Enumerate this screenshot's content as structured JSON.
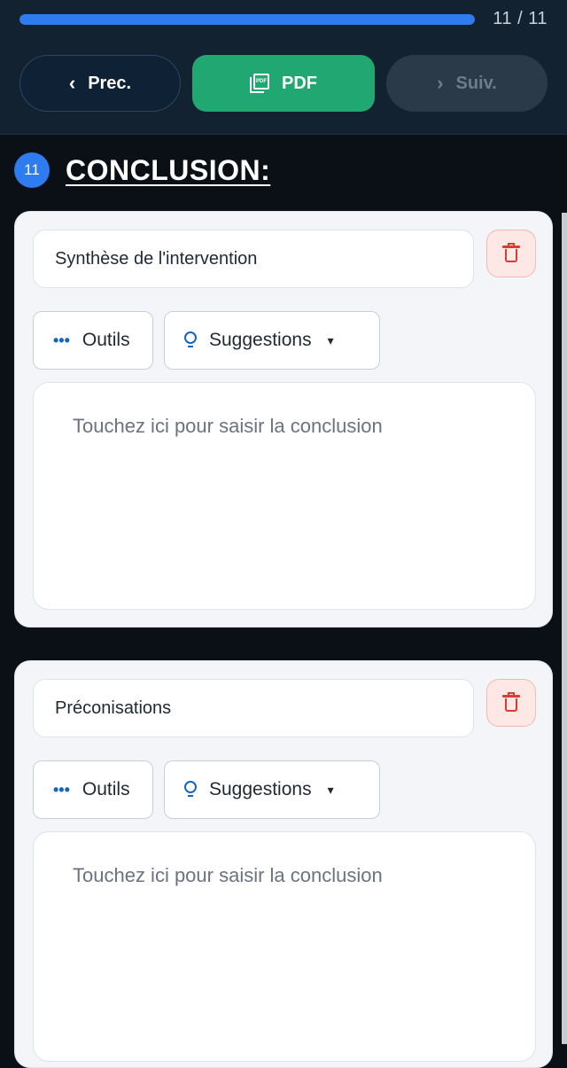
{
  "progress": {
    "label": "11 / 11",
    "fraction": 1.0,
    "color": "#2f7bf0"
  },
  "nav": {
    "prev_label": "Prec.",
    "pdf_label": "PDF",
    "pdf_icon_text": "PDF",
    "next_label": "Suiv."
  },
  "section": {
    "number": "11",
    "title": "CONCLUSION:"
  },
  "cards": [
    {
      "title": "Synthèse de l'intervention",
      "tools_label": "Outils",
      "suggestions_label": "Suggestions",
      "placeholder": "Touchez ici pour saisir la conclusion"
    },
    {
      "title": "Préconisations",
      "tools_label": "Outils",
      "suggestions_label": "Suggestions",
      "placeholder": "Touchez ici pour saisir la conclusion"
    }
  ],
  "colors": {
    "accent": "#2f7bf0",
    "pdf_button": "#21a872",
    "delete": "#dc3b2f",
    "icon_blue": "#1565c0"
  },
  "icons": [
    "chevron-left-icon",
    "pdf-icon",
    "chevron-right-icon",
    "dots-icon",
    "lightbulb-icon",
    "chevron-down-icon",
    "trash-icon"
  ]
}
